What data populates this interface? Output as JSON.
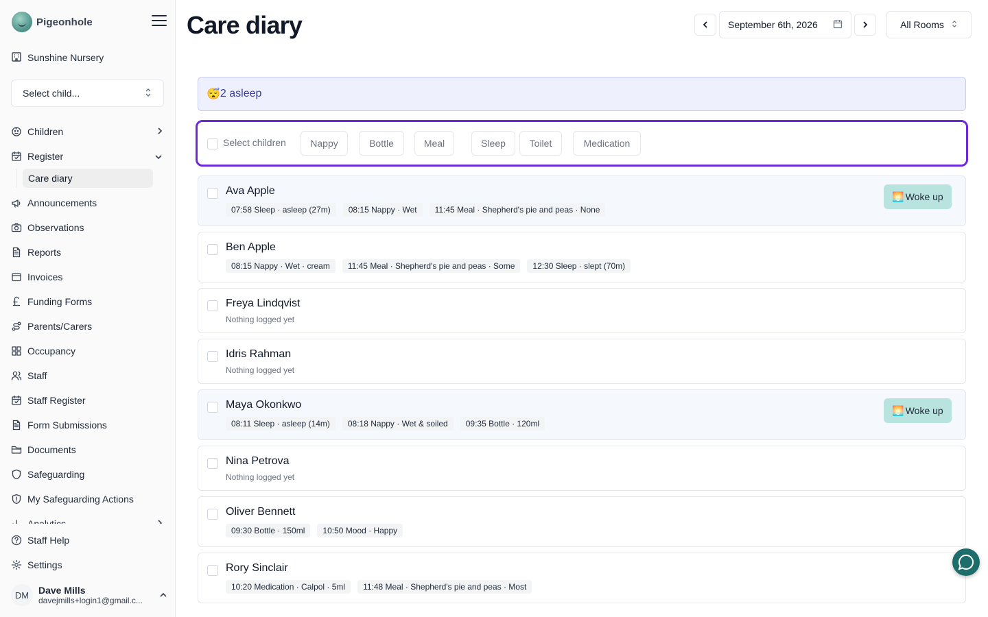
{
  "brand": {
    "name": "Pigeonhole"
  },
  "sidebar": {
    "organisation": "Sunshine Nursery",
    "child_select_placeholder": "Select child...",
    "items": [
      {
        "label": "Children",
        "icon": "child-face-icon"
      },
      {
        "label": "Register",
        "icon": "calendar-check-icon"
      },
      {
        "label": "Care diary",
        "icon": ""
      },
      {
        "label": "Announcements",
        "icon": "megaphone-icon"
      },
      {
        "label": "Observations",
        "icon": "camera-icon"
      },
      {
        "label": "Reports",
        "icon": "document-icon"
      },
      {
        "label": "Invoices",
        "icon": "wallet-icon"
      },
      {
        "label": "Funding Forms",
        "icon": "pound-icon"
      },
      {
        "label": "Parents/Carers",
        "icon": "route-icon"
      },
      {
        "label": "Occupancy",
        "icon": "grid-icon"
      },
      {
        "label": "Staff",
        "icon": "users-icon"
      },
      {
        "label": "Staff Register",
        "icon": "calendar-check-icon"
      },
      {
        "label": "Form Submissions",
        "icon": "document-icon"
      },
      {
        "label": "Documents",
        "icon": "folder-icon"
      },
      {
        "label": "Safeguarding",
        "icon": "shield-icon"
      },
      {
        "label": "My Safeguarding Actions",
        "icon": "shield-alert-icon"
      },
      {
        "label": "Analytics",
        "icon": "bar-chart-icon"
      }
    ],
    "bottom_items": [
      {
        "label": "Staff Help",
        "icon": "help-circle-icon"
      },
      {
        "label": "Settings",
        "icon": "gear-icon"
      }
    ],
    "user": {
      "initials": "DM",
      "name": "Dave Mills",
      "email": "davejmills+login1@gmail.c..."
    }
  },
  "header": {
    "title": "Care diary",
    "date": "September 6th, 2026",
    "room": "All Rooms"
  },
  "banner": {
    "emoji": "😴",
    "text": "2 asleep"
  },
  "toolbar": {
    "select_label": "Select children",
    "actions": [
      "Nappy",
      "Bottle",
      "Meal",
      "Sleep",
      "Toilet",
      "Medication"
    ]
  },
  "children": [
    {
      "name": "Ava Apple",
      "asleep": true,
      "action_emoji": "🌅",
      "action": "Woke up",
      "logs": [
        "07:58 Sleep · asleep (27m)",
        "08:15 Nappy · Wet",
        "11:45 Meal · Shepherd's pie and peas · None"
      ]
    },
    {
      "name": "Ben Apple",
      "asleep": false,
      "logs": [
        "08:15 Nappy · Wet · cream",
        "11:45 Meal · Shepherd's pie and peas · Some",
        "12:30 Sleep · slept (70m)"
      ]
    },
    {
      "name": "Freya Lindqvist",
      "asleep": false,
      "empty": "Nothing logged yet",
      "logs": []
    },
    {
      "name": "Idris Rahman",
      "asleep": false,
      "empty": "Nothing logged yet",
      "logs": []
    },
    {
      "name": "Maya Okonkwo",
      "asleep": true,
      "action_emoji": "🌅",
      "action": "Woke up",
      "logs": [
        "08:11 Sleep · asleep (14m)",
        "08:18 Nappy · Wet & soiled",
        "09:35 Bottle · 120ml"
      ]
    },
    {
      "name": "Nina Petrova",
      "asleep": false,
      "empty": "Nothing logged yet",
      "logs": []
    },
    {
      "name": "Oliver Bennett",
      "asleep": false,
      "logs": [
        "09:30 Bottle · 150ml",
        "10:50 Mood · Happy"
      ]
    },
    {
      "name": "Rory Sinclair",
      "asleep": false,
      "logs": [
        "10:20 Medication · Calpol · 5ml",
        "11:48 Meal · Shepherd's pie and peas · Most"
      ]
    }
  ],
  "colors": {
    "accent": "#6d28d9",
    "banner_bg": "#eef0fd",
    "woke_button": "#b9e3df",
    "chat_fab": "#1d6e6b"
  }
}
